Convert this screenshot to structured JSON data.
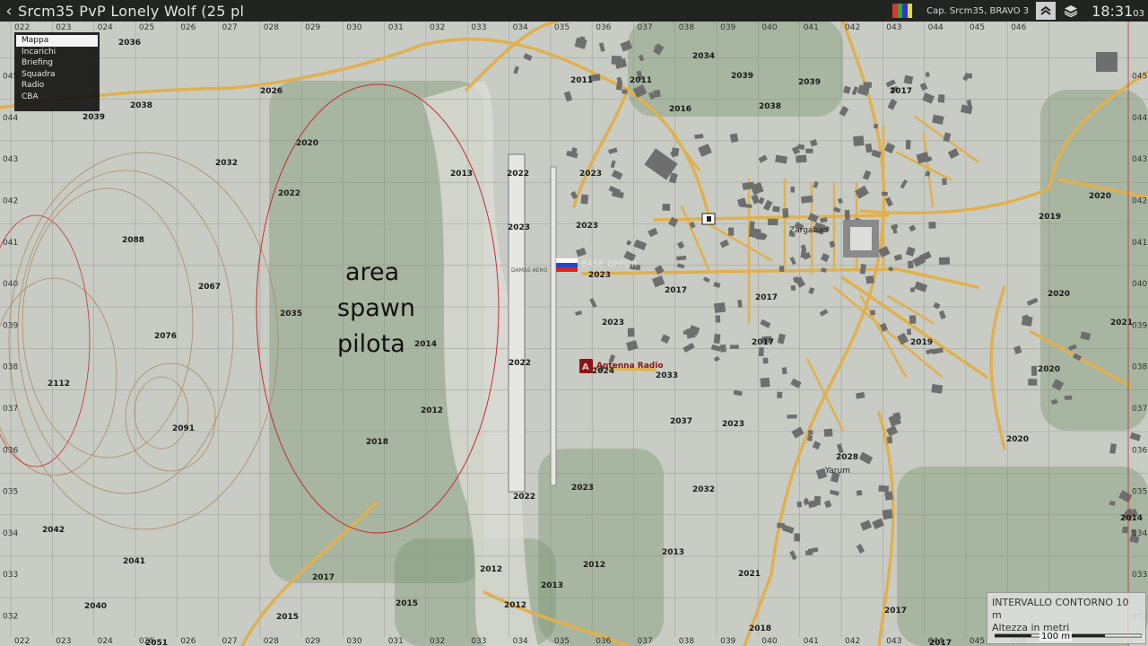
{
  "window": {
    "title": "Srcm35 PvP Lonely Wolf (25 pl",
    "unit": "Cap. Srcm35, BRAVO 3",
    "clock": "18:31",
    "clock_seconds": "03"
  },
  "icons": {
    "back": "chevron-left-icon",
    "side_flag": "side-color-flag-icon",
    "markers": "chevrons-up-icon",
    "layers": "layers-icon"
  },
  "menu": {
    "items": [
      "Mappa",
      "Incarichi",
      "Briefing",
      "Squadra",
      "Radio",
      "CBA"
    ],
    "selected": "Mappa"
  },
  "map": {
    "grid_x": [
      "022",
      "023",
      "024",
      "025",
      "026",
      "027",
      "028",
      "029",
      "030",
      "031",
      "032",
      "033",
      "034",
      "035",
      "036",
      "037",
      "038",
      "039",
      "040",
      "041",
      "042",
      "043",
      "044",
      "045",
      "046"
    ],
    "grid_y": [
      "045",
      "044",
      "043",
      "042",
      "041",
      "040",
      "039",
      "038",
      "037",
      "036",
      "035",
      "034",
      "033",
      "032"
    ],
    "annotation": [
      "area",
      "spawn",
      "pilota"
    ],
    "places": {
      "town1": "Zargabad",
      "town2": "Yarum",
      "airfield": "DAMAS AERO",
      "base": "BASE OPFOR",
      "antenna": "Antenna Radio"
    },
    "elevations": [
      {
        "v": "2036"
      },
      {
        "v": "2026"
      },
      {
        "v": "2039"
      },
      {
        "v": "2038"
      },
      {
        "v": "2020"
      },
      {
        "v": "2032"
      },
      {
        "v": "2022"
      },
      {
        "v": "2088"
      },
      {
        "v": "2067"
      },
      {
        "v": "2035"
      },
      {
        "v": "2076"
      },
      {
        "v": "2112"
      },
      {
        "v": "2091"
      },
      {
        "v": "2018"
      },
      {
        "v": "2012"
      },
      {
        "v": "2014"
      },
      {
        "v": "2013"
      },
      {
        "v": "2022"
      },
      {
        "v": "2023"
      },
      {
        "v": "2023"
      },
      {
        "v": "2023"
      },
      {
        "v": "2022"
      },
      {
        "v": "2022"
      },
      {
        "v": "2023"
      },
      {
        "v": "2024"
      },
      {
        "v": "2033"
      },
      {
        "v": "2037"
      },
      {
        "v": "2032"
      },
      {
        "v": "2023"
      },
      {
        "v": "2017"
      },
      {
        "v": "2017"
      },
      {
        "v": "2017"
      },
      {
        "v": "2011"
      },
      {
        "v": "2011"
      },
      {
        "v": "2016"
      },
      {
        "v": "2034"
      },
      {
        "v": "2039"
      },
      {
        "v": "2038"
      },
      {
        "v": "2039"
      },
      {
        "v": "2017"
      },
      {
        "v": "2020"
      },
      {
        "v": "2019"
      },
      {
        "v": "2020"
      },
      {
        "v": "2021"
      },
      {
        "v": "2020"
      },
      {
        "v": "2019"
      },
      {
        "v": "2020"
      },
      {
        "v": "2028"
      },
      {
        "v": "2023"
      },
      {
        "v": "2042"
      },
      {
        "v": "2041"
      },
      {
        "v": "2040"
      },
      {
        "v": "2017"
      },
      {
        "v": "2015"
      },
      {
        "v": "2015"
      },
      {
        "v": "2012"
      },
      {
        "v": "2013"
      },
      {
        "v": "2012"
      },
      {
        "v": "2012"
      },
      {
        "v": "2013"
      },
      {
        "v": "2021"
      },
      {
        "v": "2018"
      },
      {
        "v": "2017"
      },
      {
        "v": "2014"
      },
      {
        "v": "2051"
      },
      {
        "v": "2023"
      },
      {
        "v": "2017"
      }
    ]
  },
  "legend": {
    "contour": "INTERVALLO CONTORNO 10 m",
    "altitude": "Altezza in metri",
    "scale": "100 m"
  },
  "colors": {
    "road": "#e0b050",
    "building": "#6e6e6e",
    "grid": "#8f928a",
    "elevation_circle": "#c03030",
    "contour": "#b08866",
    "vegetation": "#7f9a78",
    "terrain": "#c9ccc4"
  }
}
